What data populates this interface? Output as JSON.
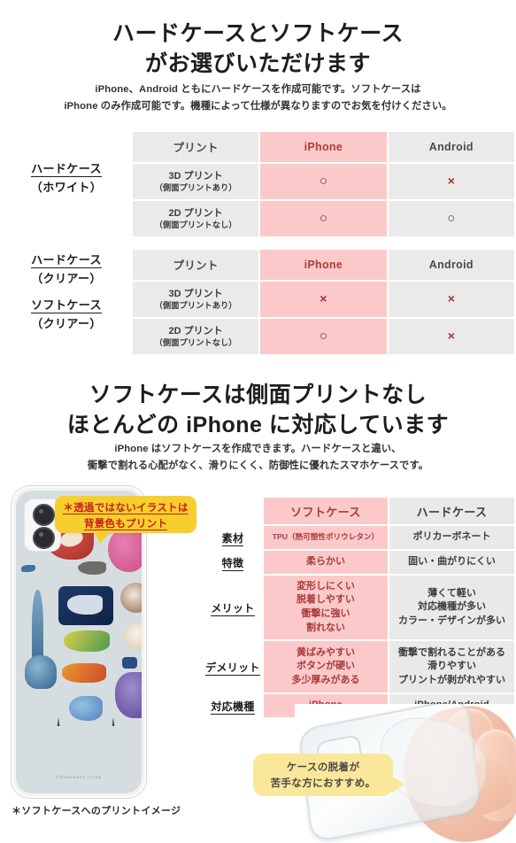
{
  "section1": {
    "heading_lines": [
      "ハードケースとソフトケース",
      "がお選びいただけます"
    ],
    "sub_lines": [
      "iPhone、Android ともにハードケースを作成可能です。ソフトケースは",
      "iPhone のみ作成可能です。機種によって仕様が異なりますのでお気を付けください。"
    ],
    "table_white": {
      "row_label_main": "ハードケース",
      "row_label_sub": "（ホワイト）",
      "headers": [
        "プリント",
        "iPhone",
        "Android"
      ],
      "rows": [
        {
          "print_main": "3D プリント",
          "print_sub": "（側面プリントあり）",
          "iphone": "○",
          "android": "×"
        },
        {
          "print_main": "2D プリント",
          "print_sub": "（側面プリントなし）",
          "iphone": "○",
          "android": "○"
        }
      ]
    },
    "table_clear": {
      "row_label_main_1": "ハードケース",
      "row_label_sub_1": "（クリアー）",
      "row_label_main_2": "ソフトケース",
      "row_label_sub_2": "（クリアー）",
      "headers": [
        "プリント",
        "iPhone",
        "Android"
      ],
      "rows": [
        {
          "print_main": "3D プリント",
          "print_sub": "（側面プリントあり）",
          "iphone": "×",
          "android": "×"
        },
        {
          "print_main": "2D プリント",
          "print_sub": "（側面プリントなし）",
          "iphone": "○",
          "android": "×"
        }
      ]
    }
  },
  "section2": {
    "heading_lines": [
      "ソフトケースは側面プリントなし",
      "ほとんどの iPhone に対応しています"
    ],
    "sub_lines": [
      "iPhone はソフトケースを作成できます。ハードケースと違い、",
      "衝撃で割れる心配がなく、滑りにくく、防御性に優れたスマホケースです。"
    ],
    "compare_table": {
      "headers": [
        "ソフトケース",
        "ハードケース"
      ],
      "rows": [
        {
          "label": "素材",
          "soft": "TPU（熱可塑性ポリウレタン）",
          "hard": "ポリカーボネート"
        },
        {
          "label": "特徴",
          "soft": "柔らかい",
          "hard": "固い・曲がりにくい"
        },
        {
          "label": "メリット",
          "soft": "変形しにくい\n脱着しやすい\n衝撃に強い\n割れない",
          "hard": "薄くて軽い\n対応機種が多い\nカラー・デザインが多い"
        },
        {
          "label": "デメリット",
          "soft": "黄ばみやすい\nボタンが硬い\n多少厚みがある",
          "hard": "衝撃で割れることがある\n滑りやすい\nプリントが剥がれやすい"
        },
        {
          "label": "対応機種",
          "soft": "iPhone",
          "hard": "iPhone/Android"
        }
      ]
    },
    "callout_print": {
      "line1": "＊透過ではないイラストは",
      "line2": "背景色もプリント"
    },
    "callout_case": {
      "line1": "ケースの脱着が",
      "line2": "苦手な方におすすめ。"
    },
    "phone_signature": "Choumoken iroha",
    "footnote": "＊ソフトケースへのプリントイメージ"
  },
  "colors": {
    "pink_cell": "#fbc9c9",
    "gray_cell": "#eaeaea",
    "pink_text": "#a83b3b",
    "yellow_strong": "#f6cf2e",
    "yellow_light": "#fbe79a",
    "red_text": "#c62020"
  }
}
